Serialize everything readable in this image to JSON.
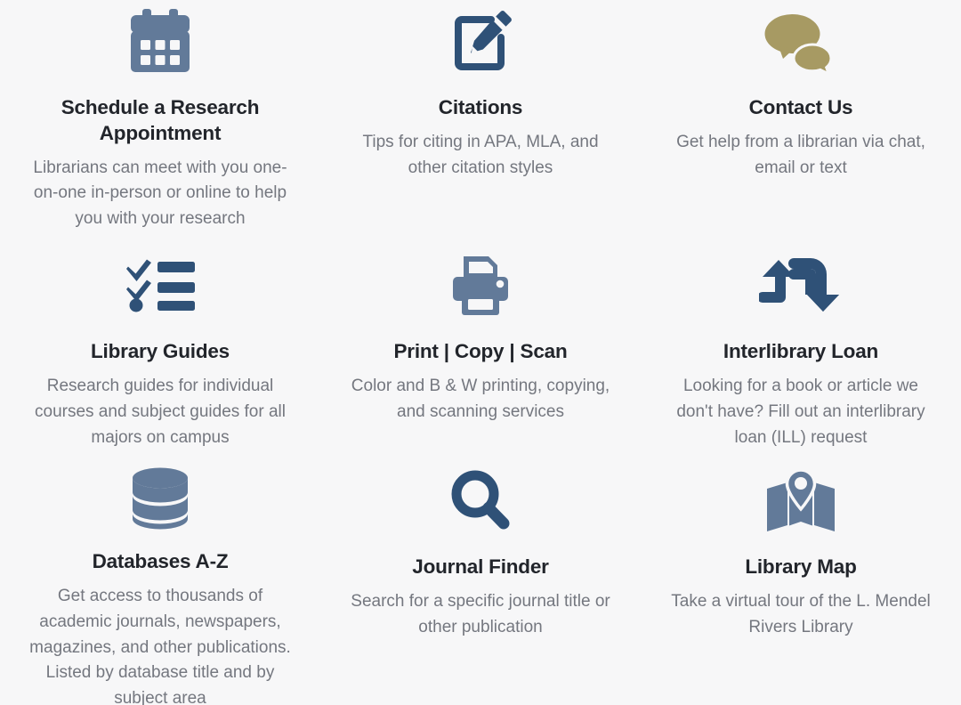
{
  "page": {
    "background_color": "#f7f7f8",
    "title_color": "#22252b",
    "description_color": "#74777f"
  },
  "colors": {
    "slate_blue": "#627a99",
    "navy_blue": "#2f5177",
    "gold": "#a79a63"
  },
  "cards": [
    {
      "icon": "calendar-icon",
      "icon_color": "#627a99",
      "title": "Schedule a Research Appointment",
      "description": "Librarians can meet with you one-on-one in-person or online to help you with your research"
    },
    {
      "icon": "edit-pencil-square-icon",
      "icon_color": "#2f5177",
      "title": "Citations",
      "description": "Tips for citing in APA, MLA, and other citation styles"
    },
    {
      "icon": "speech-bubbles-icon",
      "icon_color": "#a79a63",
      "title": "Contact Us",
      "description": "Get help from a librarian via chat, email or text"
    },
    {
      "icon": "checklist-icon",
      "icon_color": "#2f5177",
      "title": "Library Guides",
      "description": "Research guides for individual courses and subject guides for all majors on campus"
    },
    {
      "icon": "printer-icon",
      "icon_color": "#627a99",
      "title": "Print | Copy | Scan",
      "description": "Color and B & W printing, copying, and scanning services"
    },
    {
      "icon": "loop-arrows-icon",
      "icon_color": "#2f5177",
      "title": "Interlibrary Loan",
      "description": "Looking for a book or article we don't have? Fill out an interlibrary loan (ILL) request"
    },
    {
      "icon": "database-cylinder-icon",
      "icon_color": "#627a99",
      "title": "Databases A-Z",
      "description": "Get access to thousands of academic journals, newspapers, magazines, and other publications. Listed by database title and by subject area"
    },
    {
      "icon": "magnifying-glass-icon",
      "icon_color": "#2f5177",
      "title": "Journal Finder",
      "description": "Search for a specific journal title or other publication"
    },
    {
      "icon": "map-pin-icon",
      "icon_color": "#627a99",
      "title": "Library Map",
      "description": "Take a virtual tour of the L. Mendel Rivers Library"
    }
  ]
}
